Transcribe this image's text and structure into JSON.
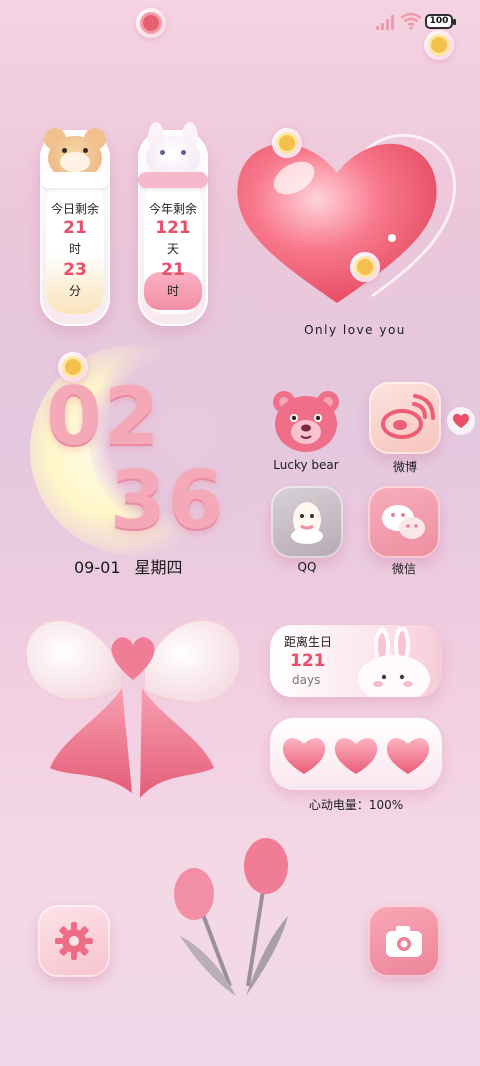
{
  "status_bar": {
    "battery_level": "100",
    "signal": "signal-bars-icon",
    "wifi": "wifi-icon"
  },
  "countdown_today": {
    "label": "今日剩余",
    "hours": "21",
    "hours_unit": "时",
    "minutes": "23",
    "minutes_unit": "分"
  },
  "countdown_year": {
    "label": "今年剩余",
    "days": "121",
    "days_unit": "天",
    "hours": "21",
    "hours_unit": "时"
  },
  "heart_widget": {
    "caption": "Only love you"
  },
  "clock": {
    "hour": "02",
    "minute": "36",
    "date": "09-01",
    "weekday": "星期四"
  },
  "apps": {
    "lucky_bear": "Lucky bear",
    "weibo": "微博",
    "qq": "QQ",
    "wechat": "微信"
  },
  "birthday": {
    "label": "距离生日",
    "days": "121",
    "unit": "days"
  },
  "love_battery": {
    "caption": "心动电量：100%"
  },
  "colors": {
    "accent": "#e8506a",
    "pink": "#f28ea6",
    "background": "#ecc7da"
  }
}
